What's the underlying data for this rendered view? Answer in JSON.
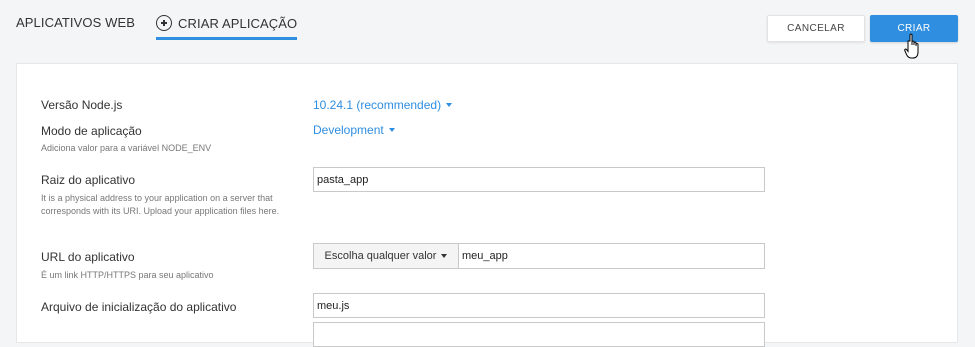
{
  "header": {
    "tab_web_apps": "APLICATIVOS WEB",
    "tab_create_app": "CRIAR APLICAÇÃO",
    "cancel_label": "CANCELAR",
    "create_label": "CRIAR"
  },
  "form": {
    "node_version": {
      "label": "Versão Node.js",
      "value": "10.24.1 (recommended)"
    },
    "app_mode": {
      "label": "Modo de aplicação",
      "hint": "Adiciona valor para a variável NODE_ENV",
      "value": "Development"
    },
    "app_root": {
      "label": "Raiz do aplicativo",
      "hint": "It is a physical address to your application on a server that corresponds with its URI. Upload your application files here.",
      "value": "pasta_app"
    },
    "app_url": {
      "label": "URL do aplicativo",
      "hint": "É um link HTTP/HTTPS para seu aplicativo",
      "domain_select": "Escolha qualquer valor",
      "value": "meu_app"
    },
    "startup_file": {
      "label": "Arquivo de inicialização do aplicativo",
      "value": "meu.js"
    }
  },
  "colors": {
    "accent": "#2f8ee0"
  },
  "icons": {
    "create_tab": "plus-circle-icon",
    "cursor": "hand-pointer-icon",
    "dropdown": "caret-down-icon"
  }
}
